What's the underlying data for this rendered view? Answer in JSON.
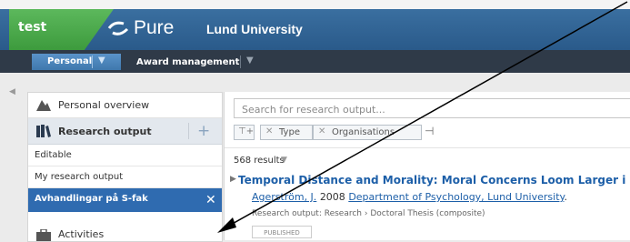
{
  "header": {
    "env_label": "test",
    "logo_text": "Pure",
    "university": "Lund University"
  },
  "nav": {
    "personal_label": "Personal",
    "award_label": "Award management"
  },
  "sidebar": {
    "overview": "Personal overview",
    "research_output": "Research output",
    "editable": "Editable",
    "my_research_output": "My research output",
    "avhandlingar": "Avhandlingar på S-fak",
    "activities": "Activities"
  },
  "search": {
    "placeholder": "Search for research output..."
  },
  "filters": {
    "type": "Type",
    "organisations": "Organisations"
  },
  "results": {
    "count": "568 results"
  },
  "result": {
    "title": "Temporal Distance and Morality: Moral Concerns Loom Larger i",
    "author": "Agerström, J.",
    "year": "2008",
    "department": "Department of Psychology, Lund University",
    "type": "Research output: Research › Doctoral Thesis (composite)",
    "status": "PUBLISHED"
  },
  "colors": {
    "header_blue": "#2f6399",
    "green": "#4caf50",
    "selected_blue": "#2f6bb0",
    "link": "#1d5fa8"
  }
}
